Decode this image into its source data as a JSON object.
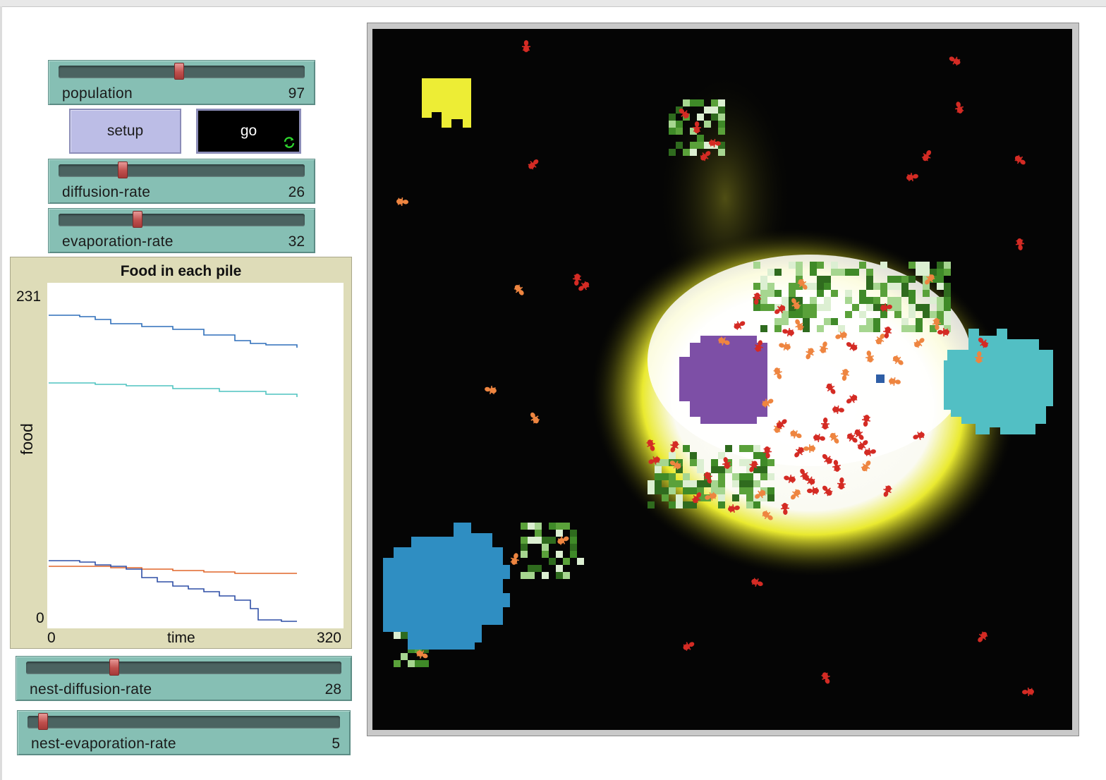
{
  "sliders": {
    "population": {
      "label": "population",
      "value": "97",
      "fraction": 0.49
    },
    "diffusion_rate": {
      "label": "diffusion-rate",
      "value": "26",
      "fraction": 0.26
    },
    "evaporation_rate": {
      "label": "evaporation-rate",
      "value": "32",
      "fraction": 0.32
    },
    "nest_diffusion_rate": {
      "label": "nest-diffusion-rate",
      "value": "28",
      "fraction": 0.28
    },
    "nest_evaporation_rate": {
      "label": "nest-evaporation-rate",
      "value": "5",
      "fraction": 0.05
    }
  },
  "buttons": {
    "setup": "setup",
    "go": "go",
    "go_icon": "forever-loop-icon"
  },
  "plot": {
    "title": "Food in each pile",
    "ylabel": "food",
    "xlabel": "time",
    "ymin_label": "0",
    "ymax_label": "231",
    "xmin_label": "0",
    "xmax_label": "320"
  },
  "chart_data": {
    "type": "line",
    "title": "Food in each pile",
    "xlabel": "time",
    "ylabel": "food",
    "xlim": [
      0,
      320
    ],
    "ylim": [
      0,
      231
    ],
    "series": [
      {
        "color": "#2f6fba",
        "x": [
          0,
          40,
          60,
          80,
          120,
          160,
          200,
          240,
          260,
          280,
          300,
          320
        ],
        "y": [
          218,
          217,
          215,
          212,
          210,
          208,
          204,
          200,
          198,
          197,
          197,
          195
        ]
      },
      {
        "color": "#4fc4c0",
        "x": [
          0,
          60,
          100,
          160,
          220,
          280,
          320
        ],
        "y": [
          170,
          169,
          168,
          166,
          164,
          162,
          160
        ]
      },
      {
        "color": "#e0662a",
        "x": [
          0,
          80,
          120,
          160,
          200,
          240,
          320
        ],
        "y": [
          40,
          39,
          38,
          37,
          36,
          35,
          35
        ]
      },
      {
        "color": "#2f4fa6",
        "x": [
          0,
          40,
          60,
          80,
          100,
          120,
          140,
          160,
          180,
          200,
          220,
          240,
          260,
          270,
          280,
          300,
          320
        ],
        "y": [
          44,
          43,
          41,
          40,
          38,
          32,
          29,
          26,
          24,
          22,
          19,
          16,
          10,
          2,
          2,
          1,
          1
        ]
      }
    ]
  },
  "world": {
    "colors": {
      "background": "#050505",
      "pile_yellow": "#eded35",
      "pile_purple": "#7d4fa6",
      "pile_cyan": "#52bfc4",
      "pile_blue": "#2f8ec2",
      "ant_red": "#d42b24",
      "ant_orange": "#ee8540"
    }
  }
}
